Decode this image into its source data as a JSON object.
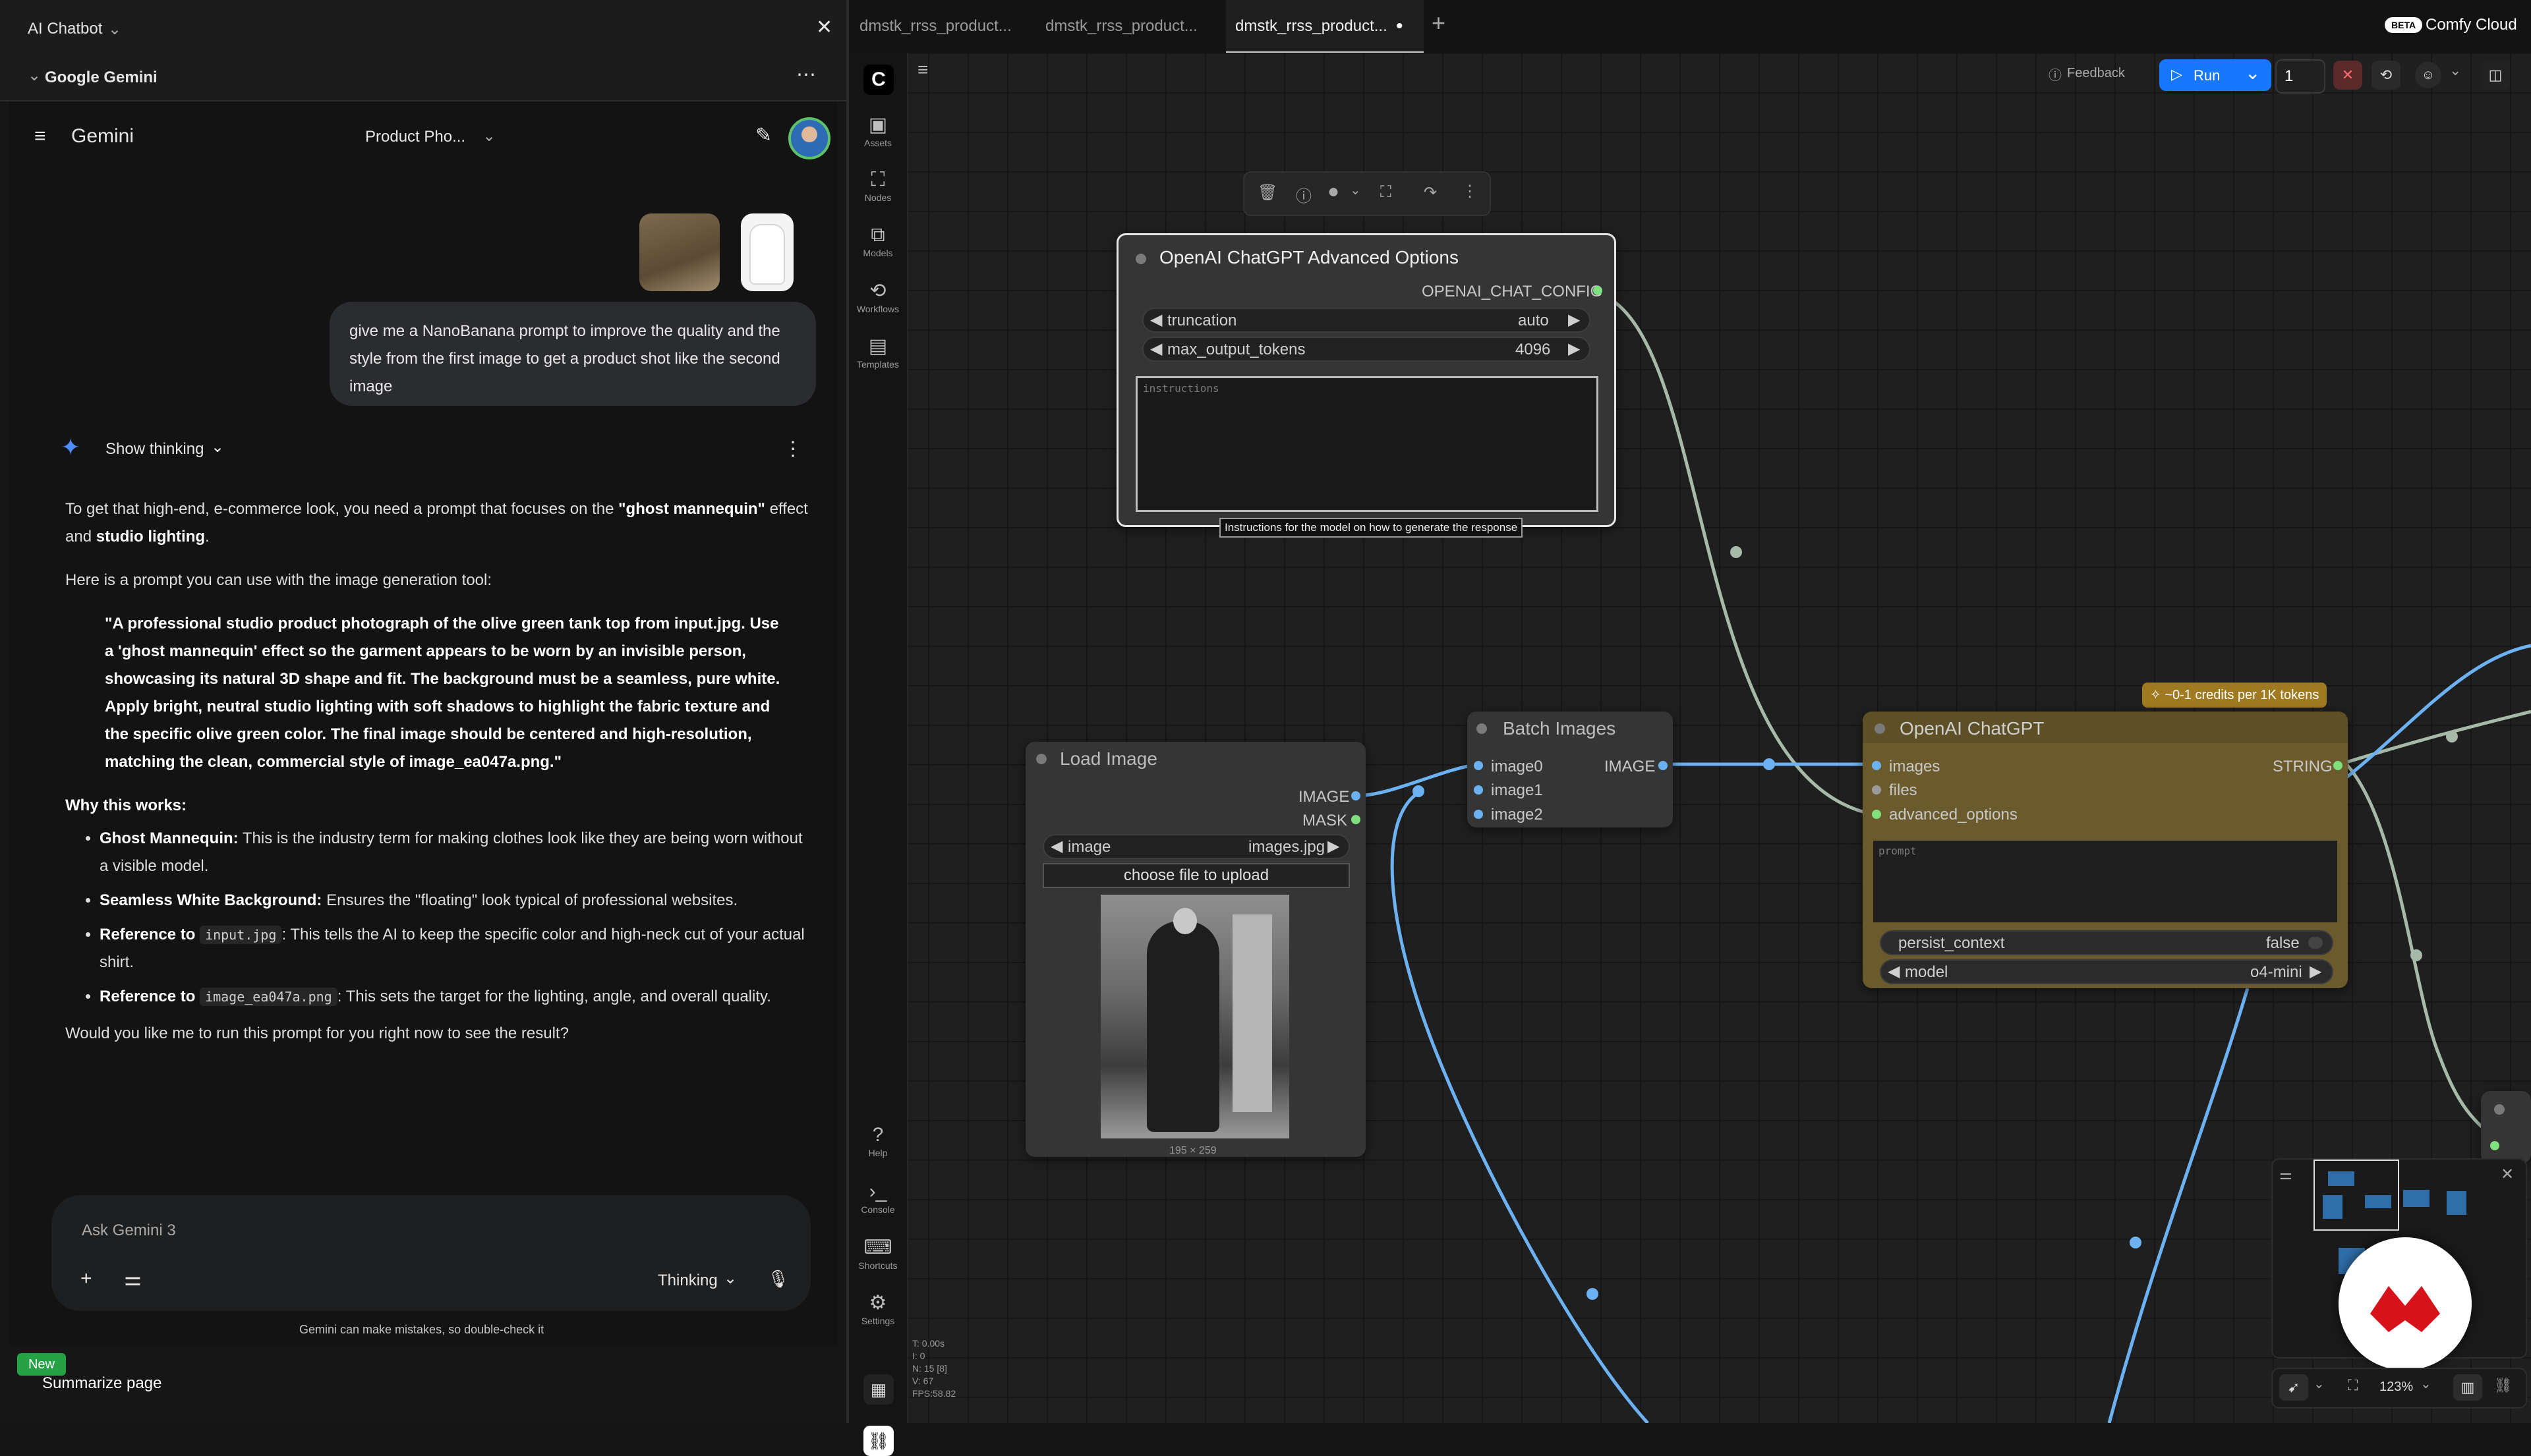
{
  "chatbot": {
    "panel_title": "AI Chatbot",
    "provider": "Google Gemini",
    "gemini_title": "Gemini",
    "conversation_title": "Product Pho...",
    "user_message": "give me a NanoBanana prompt to improve the quality and the style from the first image to get a product shot like the second image",
    "show_thinking": "Show thinking",
    "answer": {
      "intro_a": "To get that high-end, e-commerce look, you need a prompt that focuses on the ",
      "intro_b": "\"ghost mannequin\"",
      "intro_c": " effect and ",
      "intro_d": "studio lighting",
      "intro_e": ".",
      "lead": "Here is a prompt you can use with the image generation tool:",
      "quote": "\"A professional studio product photograph of the olive green tank top from input.jpg. Use a 'ghost mannequin' effect so the garment appears to be worn by an invisible person, showcasing its natural 3D shape and fit. The background must be a seamless, pure white. Apply bright, neutral studio lighting with soft shadows to highlight the fabric texture and the specific olive green color. The final image should be centered and high-resolution, matching the clean, commercial style of image_ea047a.png.\"",
      "why_heading": "Why this works:",
      "bullets": [
        {
          "bold": "Ghost Mannequin:",
          "text": " This is the industry term for making clothes look like they are being worn without a visible model."
        },
        {
          "bold": "Seamless White Background:",
          "text": " Ensures the \"floating\" look typical of professional websites."
        },
        {
          "bold": "Reference to",
          "code": "input.jpg",
          "text": ": This tells the AI to keep the specific color and high-neck cut of your actual shirt."
        },
        {
          "bold": "Reference to",
          "code": "image_ea047a.png",
          "text": ": This sets the target for the lighting, angle, and overall quality."
        }
      ],
      "closing": "Would you like me to run this prompt for you right now to see the result?"
    },
    "input_placeholder": "Ask Gemini 3",
    "mode": "Thinking",
    "disclaimer": "Gemini can make mistakes, so double-check it",
    "new_badge": "New",
    "summarize": "Summarize page"
  },
  "comfy": {
    "tabs": [
      "dmstk_rrss_product...",
      "dmstk_rrss_product...",
      "dmstk_rrss_product..."
    ],
    "add_tab": "+",
    "cloud_badge": "BETA",
    "cloud_label": "Comfy Cloud",
    "rail": [
      {
        "icon": "assets-icon",
        "label": "Assets",
        "glyph": "▣"
      },
      {
        "icon": "nodes-icon",
        "label": "Nodes",
        "glyph": "⛶"
      },
      {
        "icon": "models-icon",
        "label": "Models",
        "glyph": "⧉"
      },
      {
        "icon": "workflows-icon",
        "label": "Workflows",
        "glyph": "⟲"
      },
      {
        "icon": "templates-icon",
        "label": "Templates",
        "glyph": "▤"
      }
    ],
    "rail_bottom": [
      {
        "icon": "help-icon",
        "label": "Help",
        "glyph": "?"
      },
      {
        "icon": "console-icon",
        "label": "Console",
        "glyph": "›_"
      },
      {
        "icon": "shortcuts-icon",
        "label": "Shortcuts",
        "glyph": "⌨"
      },
      {
        "icon": "settings-icon",
        "label": "Settings",
        "glyph": "⚙"
      }
    ],
    "toolbar": {
      "feedback": "Feedback",
      "run": "Run",
      "queue_count": "1"
    },
    "stats": [
      "T: 0.00s",
      "I: 0",
      "N: 15 [8]",
      "V: 67",
      "FPS:58.82"
    ],
    "advanced_node": {
      "title": "OpenAI ChatGPT Advanced Options",
      "output": "OPENAI_CHAT_CONFIG",
      "w1_label": "truncation",
      "w1_value": "auto",
      "w2_label": "max_output_tokens",
      "w2_value": "4096",
      "placeholder": "instructions",
      "tooltip": "Instructions for the model on how to generate the response"
    },
    "load_node": {
      "title": "Load Image",
      "out1": "IMAGE",
      "out2": "MASK",
      "w_label": "image",
      "w_value": "images.jpg",
      "upload": "choose file to upload",
      "dims": "195 × 259"
    },
    "batch_node": {
      "title": "Batch Images",
      "in1": "image0",
      "in2": "image1",
      "in3": "image2",
      "output": "IMAGE"
    },
    "chatgpt_node": {
      "title": "OpenAI ChatGPT",
      "credits": "~0-1 credits per 1K tokens",
      "in1": "images",
      "in2": "files",
      "in3": "advanced_options",
      "output": "STRING",
      "placeholder": "prompt",
      "w1_label": "persist_context",
      "w1_value": "false",
      "w2_label": "model",
      "w2_value": "o4-mini"
    },
    "zoom": "123%"
  }
}
